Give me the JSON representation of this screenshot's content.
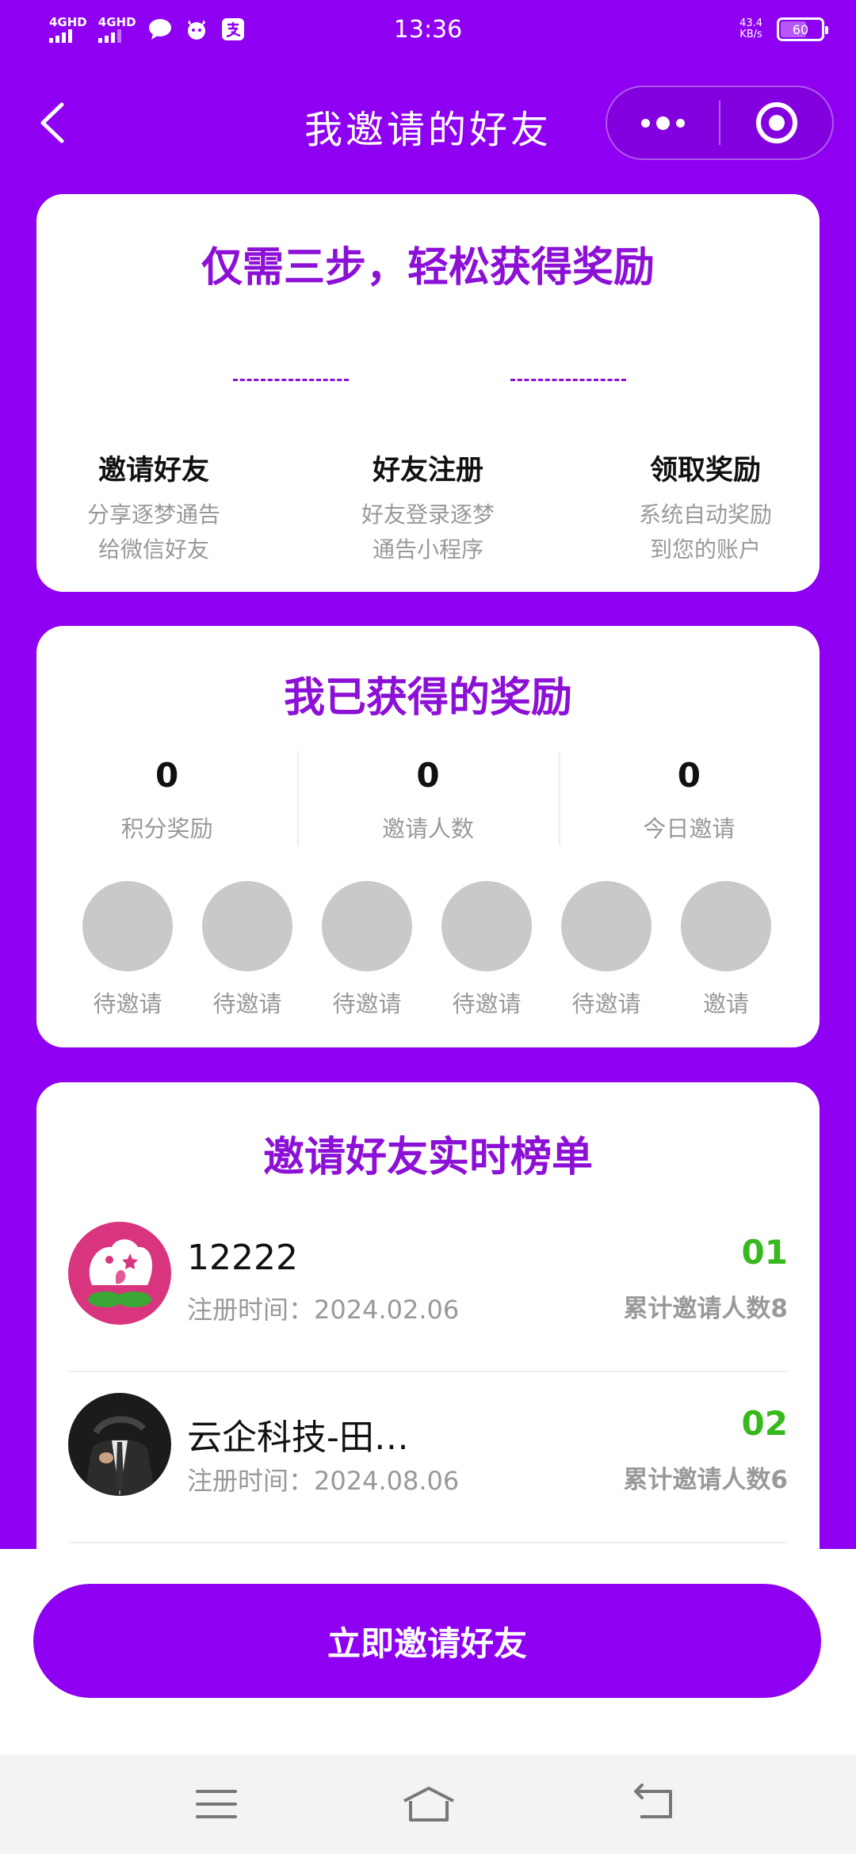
{
  "status_bar": {
    "network1": "4GHD",
    "network2": "4GHD",
    "time": "13:36",
    "speed_value": "43.4",
    "speed_unit": "KB/s",
    "battery": "60"
  },
  "nav": {
    "title": "我邀请的好友"
  },
  "steps_card": {
    "title": "仅需三步，轻松获得奖励",
    "steps": [
      {
        "title": "邀请好友",
        "desc1": "分享逐梦通告",
        "desc2": "给微信好友"
      },
      {
        "title": "好友注册",
        "desc1": "好友登录逐梦",
        "desc2": "通告小程序"
      },
      {
        "title": "领取奖励",
        "desc1": "系统自动奖励",
        "desc2": "到您的账户"
      }
    ]
  },
  "rewards_card": {
    "title": "我已获得的奖励",
    "stats": [
      {
        "value": "0",
        "label": "积分奖励"
      },
      {
        "value": "0",
        "label": "邀请人数"
      },
      {
        "value": "0",
        "label": "今日邀请"
      }
    ],
    "slots": [
      "待邀请",
      "待邀请",
      "待邀请",
      "待邀请",
      "待邀请",
      "邀请"
    ]
  },
  "ranking_card": {
    "title": "邀请好友实时榜单",
    "rows": [
      {
        "name": "12222",
        "time": "注册时间：2024.02.06",
        "rank": "01",
        "count": "累计邀请人数8"
      },
      {
        "name": "云企科技-田…",
        "time": "注册时间：2024.08.06",
        "rank": "02",
        "count": "累计邀请人数6"
      }
    ]
  },
  "invite_button": "立即邀请好友",
  "colors": {
    "brand": "#8f00f2",
    "title_purple": "#8c10d6",
    "rank_green": "#37b91d",
    "placeholder_gray": "#c9c9c9"
  }
}
